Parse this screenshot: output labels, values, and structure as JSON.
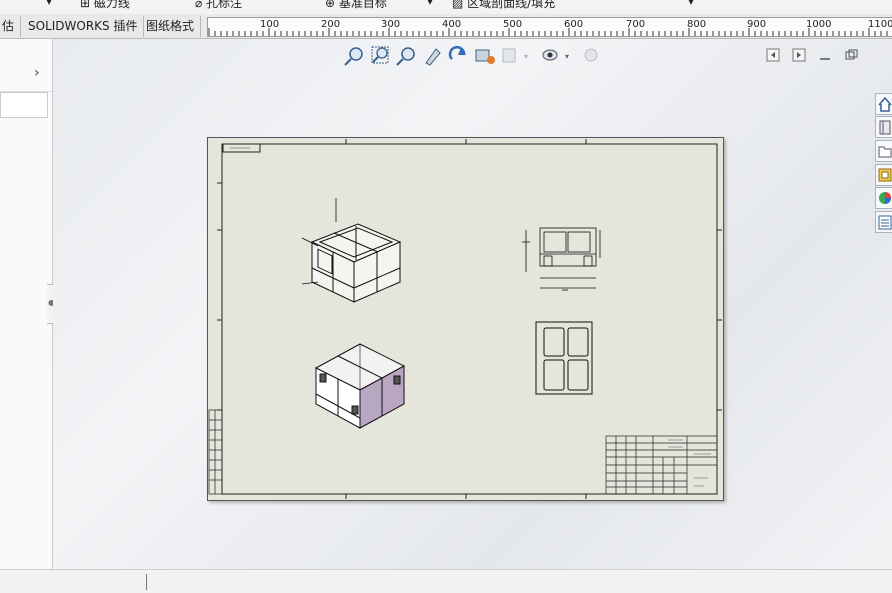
{
  "top_toolbar": {
    "item1_label": "磁力线",
    "item2_label": "孔标注",
    "item3_label": "基准目标",
    "item4_label": "区域剖面线/填充"
  },
  "tabs": [
    {
      "label": "估"
    },
    {
      "label": "SOLIDWORKS 插件"
    },
    {
      "label": "图纸格式"
    }
  ],
  "ruler": {
    "ticks": [
      "100",
      "200",
      "300",
      "400",
      "500",
      "600",
      "700",
      "800",
      "900",
      "1000",
      "1100"
    ]
  },
  "heads_up_toolbar": {
    "icons": [
      "zoom-to-fit-icon",
      "zoom-to-area-icon",
      "zoom-previous-icon",
      "pan-icon",
      "rotate-icon",
      "view-settings-icon",
      "display-style-icon",
      "hide-show-icon",
      "appearance-icon"
    ]
  },
  "task_pane": {
    "icons": [
      "home-icon",
      "design-library-icon",
      "file-explorer-icon",
      "view-palette-icon",
      "appearances-icon",
      "custom-properties-icon"
    ]
  },
  "colors": {
    "sheet_bg": "#e5e5dc",
    "shaded_view": "#b9a7c2",
    "canvas_bg": "#eceef2"
  }
}
